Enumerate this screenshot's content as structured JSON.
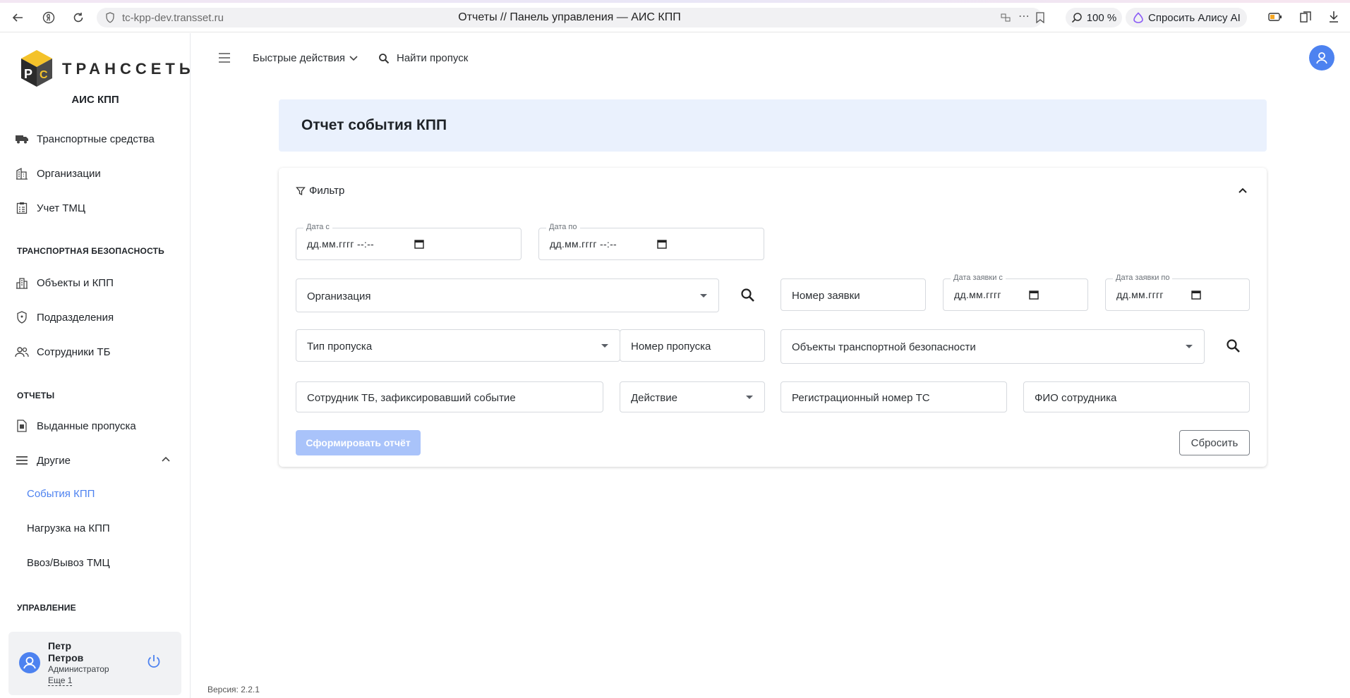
{
  "browser": {
    "url": "tc-kpp-dev.transset.ru",
    "tab_title": "Отчеты // Панель управления — АИС КПП",
    "zoom": "100 %",
    "alice": "Спросить Алису AI"
  },
  "sidebar": {
    "brand": "ТРАНССЕТЬ",
    "app_title": "АИС КПП",
    "items": [
      {
        "label": "Транспортные средства",
        "icon": "truck-icon"
      },
      {
        "label": "Организации",
        "icon": "building-icon"
      },
      {
        "label": "Учет ТМЦ",
        "icon": "clipboard-icon"
      }
    ],
    "section_security": "ТРАНСПОРТНАЯ БЕЗОПАСНОСТЬ",
    "security_items": [
      {
        "label": "Объекты и КПП",
        "icon": "city-icon"
      },
      {
        "label": "Подразделения",
        "icon": "shield-icon"
      },
      {
        "label": "Сотрудники ТБ",
        "icon": "people-icon"
      }
    ],
    "section_reports": "ОТЧЕТЫ",
    "report_items": [
      {
        "label": "Выданные пропуска",
        "icon": "document-icon"
      },
      {
        "label": "Другие",
        "icon": "list-icon"
      }
    ],
    "sub_items": [
      "События КПП",
      "Нагрузка на КПП",
      "Ввоз/Вывоз ТМЦ"
    ],
    "section_manage": "УПРАВЛЕНИЕ",
    "user": {
      "first_name": "Петр",
      "last_name": "Петров",
      "role": "Администратор",
      "more": "Еще 1"
    }
  },
  "topbar": {
    "quick_actions": "Быстрые действия",
    "find_pass": "Найти пропуск"
  },
  "page": {
    "title": "Отчет события КПП",
    "filter_label": "Фильтр",
    "date_from_label": "Дата с",
    "date_from_value": "дд.мм.гггг --:--",
    "date_to_label": "Дата по",
    "date_to_value": "дд.мм.гггг --:--",
    "organization": "Организация",
    "request_number": "Номер заявки",
    "request_date_from_label": "Дата заявки с",
    "request_date_from_value": "дд.мм.гггг",
    "request_date_to_label": "Дата заявки по",
    "request_date_to_value": "дд.мм.гггг",
    "pass_type": "Тип пропуска",
    "pass_number": "Номер пропуска",
    "security_objects": "Объекты транспортной безопасности",
    "employee_event": "Сотрудник ТБ, зафиксировавший событие",
    "action": "Действие",
    "reg_number": "Регистрационный номер ТС",
    "employee_name": "ФИО сотрудника",
    "submit": "Сформировать отчёт",
    "reset": "Сбросить"
  },
  "version": "Версия: 2.2.1",
  "colors": {
    "accent": "#4d82f0",
    "header_bg": "#eaf1fd",
    "disabled_button": "#a9c3fa"
  }
}
